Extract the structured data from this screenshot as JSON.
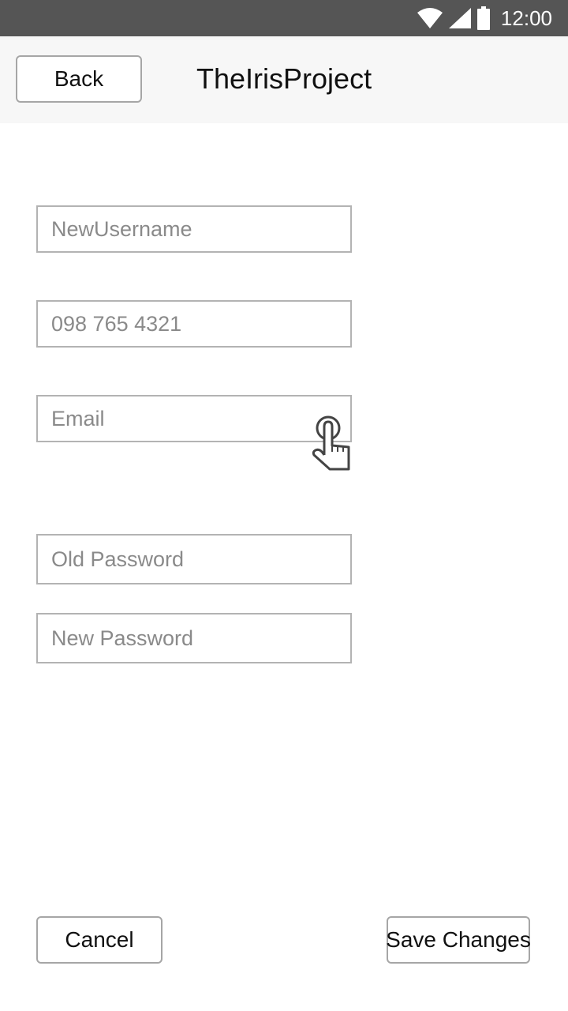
{
  "status_bar": {
    "time": "12:00",
    "background": "#555555"
  },
  "header": {
    "back_label": "Back",
    "title": "TheIrisProject"
  },
  "form": {
    "username_placeholder": "NewUsername",
    "phone_placeholder": "098 765 4321",
    "email_placeholder": "Email",
    "old_password_placeholder": "Old Password",
    "new_password_placeholder": "New Password"
  },
  "footer": {
    "cancel_label": "Cancel",
    "save_label": "Save Changes"
  },
  "icons": {
    "wifi": "wifi-icon",
    "signal": "cell-signal-icon",
    "battery": "battery-icon",
    "pointer": "hand-pointer-icon"
  }
}
